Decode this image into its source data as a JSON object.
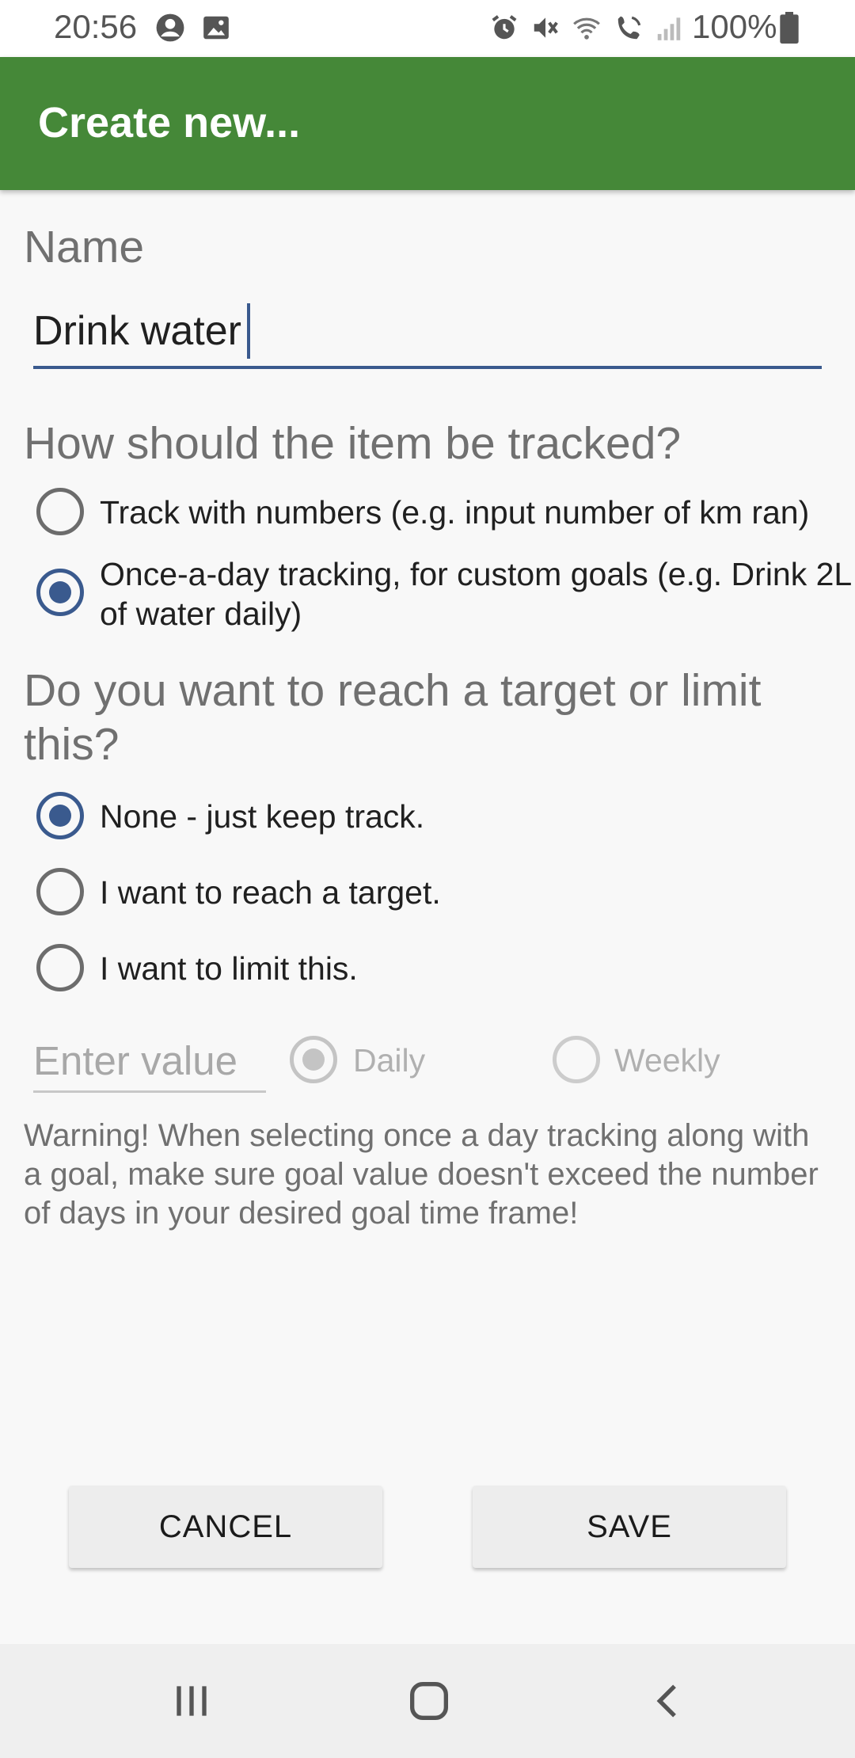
{
  "status_bar": {
    "time": "20:56",
    "battery": "100%",
    "icons": [
      "account-circle-icon",
      "image-icon",
      "alarm-icon",
      "mute-icon",
      "wifi-icon",
      "wifi-calling-icon",
      "signal-icon",
      "battery-icon"
    ]
  },
  "app_bar": {
    "title": "Create new..."
  },
  "form": {
    "name_label": "Name",
    "name_value": "Drink water",
    "tracking_question": "How should the item be tracked?",
    "tracking_options": [
      {
        "label": "Track with numbers (e.g. input number of km ran)",
        "selected": false
      },
      {
        "label": "Once-a-day tracking, for custom goals (e.g. Drink 2L of water daily)",
        "selected": true
      }
    ],
    "target_question": "Do you want to reach a target or limit this?",
    "target_options": [
      {
        "label": "None - just keep track.",
        "selected": true
      },
      {
        "label": "I want to reach a target.",
        "selected": false
      },
      {
        "label": "I want to limit this.",
        "selected": false
      }
    ],
    "value_placeholder": "Enter value",
    "period_options": [
      {
        "label": "Daily",
        "selected": true,
        "enabled": false
      },
      {
        "label": "Weekly",
        "selected": false,
        "enabled": false
      }
    ],
    "warning": "Warning! When selecting once a day tracking along with a goal, make sure goal value doesn't exceed the number of days in your desired goal time frame!"
  },
  "buttons": {
    "cancel": "CANCEL",
    "save": "SAVE"
  },
  "nav_bar": {
    "icons": [
      "recent-apps-icon",
      "home-icon",
      "back-icon"
    ]
  },
  "colors": {
    "app_bar": "#458838",
    "accent": "#3a5a8e",
    "background": "#f8f8f8"
  }
}
